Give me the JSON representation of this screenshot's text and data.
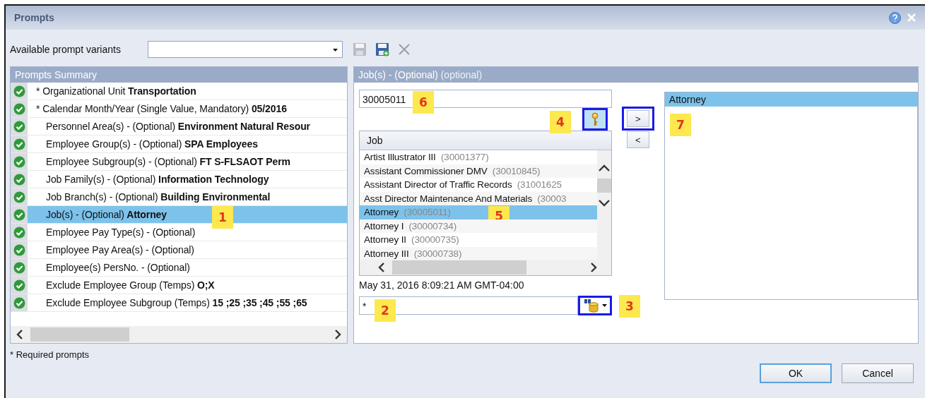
{
  "window": {
    "title": "Prompts"
  },
  "variants": {
    "label": "Available prompt variants"
  },
  "toolbar": [
    {
      "kind": "save",
      "disabled": true
    },
    {
      "kind": "save_as",
      "disabled": false
    },
    {
      "kind": "delete",
      "disabled": true
    }
  ],
  "summary": {
    "title": "Prompts Summary",
    "rows": [
      {
        "label": "* Organizational Unit",
        "value": "Transportation",
        "required": true,
        "complete": true,
        "selected": false
      },
      {
        "label": "* Calendar Month/Year (Single Value, Mandatory)",
        "value": "05/2016",
        "required": true,
        "complete": true,
        "selected": false
      },
      {
        "label": "Personnel Area(s) - (Optional)",
        "value": "Environment Natural Resour",
        "required": false,
        "complete": true,
        "selected": false
      },
      {
        "label": "Employee Group(s) - (Optional)",
        "value": "SPA Employees",
        "required": false,
        "complete": true,
        "selected": false
      },
      {
        "label": "Employee Subgroup(s) - (Optional)",
        "value": "FT S-FLSAOT Perm",
        "required": false,
        "complete": true,
        "selected": false
      },
      {
        "label": "Job Family(s) - (Optional)",
        "value": "Information Technology",
        "required": false,
        "complete": true,
        "selected": false
      },
      {
        "label": "Job Branch(s) - (Optional)",
        "value": "Building Environmental",
        "required": false,
        "complete": true,
        "selected": false
      },
      {
        "label": "Job(s) - (Optional)",
        "value": "Attorney",
        "required": false,
        "complete": true,
        "selected": true,
        "callout": "1"
      },
      {
        "label": "Employee Pay Type(s) - (Optional)",
        "required": false,
        "complete": true,
        "selected": false
      },
      {
        "label": "Employee Pay Area(s) - (Optional)",
        "required": false,
        "complete": true,
        "selected": false
      },
      {
        "label": "Employee(s) PersNo. - (Optional)",
        "required": false,
        "complete": true,
        "selected": false
      },
      {
        "label": "Exclude Employee Group (Temps)",
        "value": "O;X",
        "required": false,
        "complete": true,
        "selected": false
      },
      {
        "label": "Exclude Employee Subgroup (Temps)",
        "value": "15 ;25 ;35 ;45 ;55 ;65",
        "required": false,
        "complete": true,
        "selected": false
      }
    ]
  },
  "detail": {
    "title": "Job(s) - (Optional)",
    "hint": "(optional)",
    "search": {
      "value": "30005011",
      "callout": "6"
    },
    "key_button": {
      "highlighted": true,
      "callout": "4"
    },
    "list": {
      "column": "Job",
      "items": [
        {
          "name": "Artist Illustrator III",
          "code": "(30001377)",
          "selected": false
        },
        {
          "name": "Assistant Commissioner DMV",
          "code": "(30010845)",
          "selected": false
        },
        {
          "name": "Assistant Director of Traffic Records",
          "code": "(31001625",
          "selected": false
        },
        {
          "name": "Asst Director Maintenance And Materials",
          "code": "(30003",
          "selected": false
        },
        {
          "name": "Attorney",
          "code": "(30005011)",
          "selected": true,
          "callout": "5"
        },
        {
          "name": "Attorney I",
          "code": "(30000734)",
          "selected": false
        },
        {
          "name": "Attorney II",
          "code": "(30000735)",
          "selected": false
        },
        {
          "name": "Attorney III",
          "code": "(30000738)",
          "selected": false
        }
      ]
    },
    "timestamp": "May 31, 2016 8:09:21 AM GMT-04:00",
    "value_field": {
      "value": "*",
      "callout": "2"
    },
    "search_button": {
      "highlighted": true,
      "callout": "3"
    },
    "add_button": {
      "label": ">",
      "highlighted": true
    },
    "remove_button": {
      "label": "<",
      "highlighted": false
    },
    "selected_list": {
      "items": [
        {
          "name": "Attorney",
          "selected": true
        }
      ],
      "callout": "7"
    }
  },
  "footer": {
    "note": "* Required prompts",
    "buttons": [
      {
        "label": "OK",
        "default": true
      },
      {
        "label": "Cancel",
        "default": false
      }
    ]
  }
}
